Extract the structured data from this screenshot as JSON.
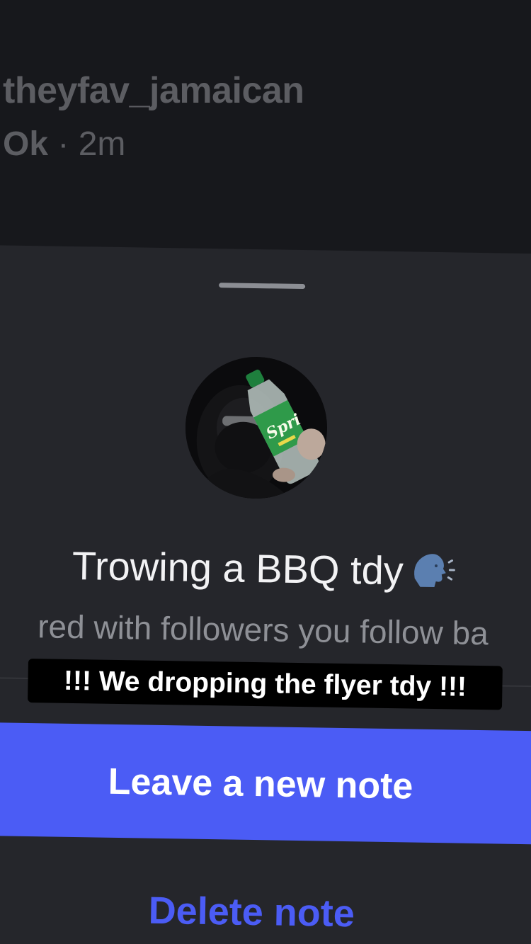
{
  "background_header": {
    "username": "theyfav_jamaican",
    "meta_prefix": "Ok",
    "meta_separator": " · ",
    "meta_time": "2m"
  },
  "sheet": {
    "note_text": "Trowing a BBQ tdy",
    "note_emoji_icon": "speaking-head-icon",
    "shared_line": "red with followers you follow ba",
    "primary_button_label": "Leave a new note",
    "delete_label": "Delete note"
  },
  "caption": {
    "text": "!!! We dropping the flyer tdy !!!"
  },
  "colors": {
    "accent": "#4b5cf5",
    "sheet_bg": "#25262b",
    "page_bg": "#17181c",
    "muted_text": "#5c5d62"
  }
}
